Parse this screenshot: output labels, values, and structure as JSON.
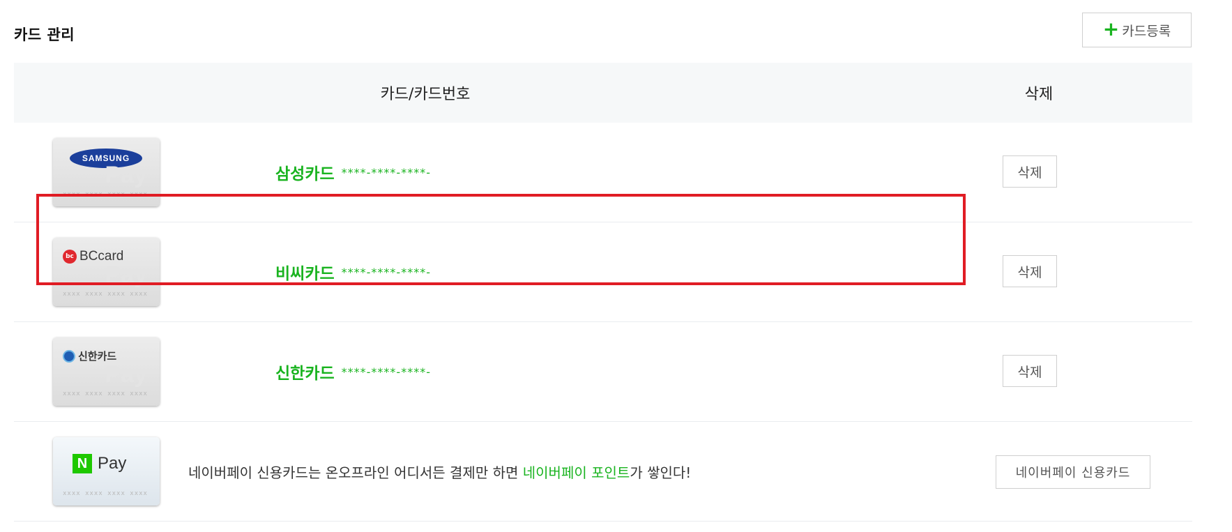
{
  "header": {
    "title": "카드 관리",
    "register_button": {
      "icon": "plus-icon",
      "label": "카드등록",
      "icon_color": "#19b31f"
    }
  },
  "table": {
    "columns": {
      "card": "카드/카드번호",
      "delete": "삭제"
    },
    "rows": [
      {
        "brand": "samsung",
        "logo_text": "SAMSUNG",
        "name": "삼성카드",
        "number": "****-****-****-",
        "delete_label": "삭제",
        "highlighted": false
      },
      {
        "brand": "bc",
        "logo_text": "BCcard",
        "name": "비씨카드",
        "number": "****-****-****-",
        "delete_label": "삭제",
        "highlighted": true
      },
      {
        "brand": "shinhan",
        "logo_text": "신한카드",
        "name": "신한카드",
        "number": "****-****-****-",
        "delete_label": "삭제",
        "highlighted": false
      }
    ],
    "promo": {
      "card_logo": {
        "badge": "N",
        "text": "Pay"
      },
      "text_before": "네이버페이 신용카드는 온오프라인 어디서든 결제만 하면 ",
      "text_highlight": "네이버페이 포인트",
      "text_after": "가 쌓인다!",
      "button_label": "네이버페이 신용카드"
    }
  },
  "colors": {
    "accent_green": "#19b31f",
    "header_bg": "#f6f8f9",
    "highlight_border": "#e01c24",
    "samsung_blue": "#1b3f9b",
    "bc_red": "#e0282e",
    "npay_green": "#1ec800"
  }
}
